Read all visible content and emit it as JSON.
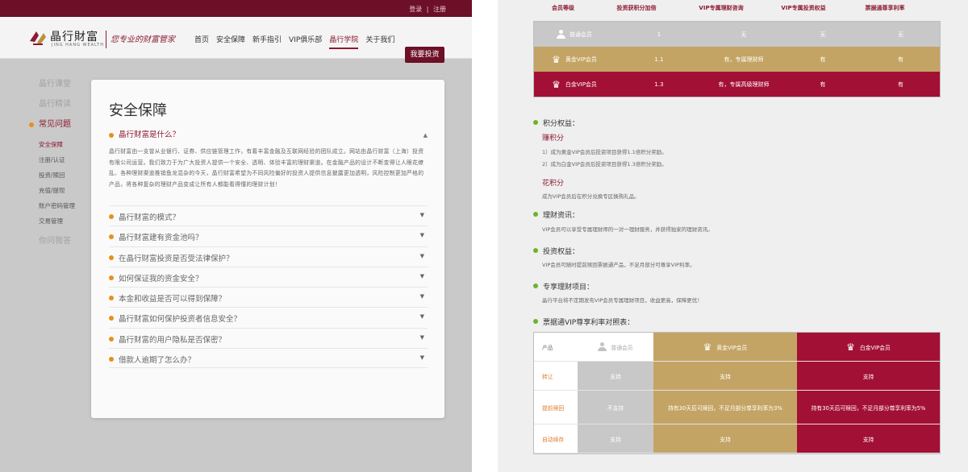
{
  "left": {
    "topbar": {
      "login": "登录",
      "sep": "|",
      "register": "注册"
    },
    "brand": {
      "name": "晶行財富",
      "sub": "JING HANG WEALTH",
      "slogan": "您专业的财富管家"
    },
    "nav": [
      "首页",
      "安全保障",
      "新手指引",
      "VIP俱乐部",
      "晶行学院",
      "关于我们"
    ],
    "nav_active_index": 4,
    "invest_button": "我要投资",
    "sidebar": {
      "items": [
        {
          "label": "晶行课堂"
        },
        {
          "label": "晶行精读"
        },
        {
          "label": "常见问题"
        }
      ],
      "subitems": [
        "安全保障",
        "注册/认证",
        "投资/赎回",
        "充值/提现",
        "账户密码管理",
        "交易管理"
      ],
      "bottom": "你问我答"
    },
    "card": {
      "title": "安全保障",
      "open_question": "晶行财富是什么？",
      "open_answer": "晶行财富由一支曾从业银行、证券、供应链管理工作，有着丰富金融及互联网经验的团队成立。网站由晶行财富（上海）投资有限公司运营。我们致力于为广大投资人提供一个安全、透明、体验丰富的理财渠道。在金融产品的设计不断变得让人眼花缭乱、各种理财渠道推销鱼龙混杂的今天，晶行财富希望为不同风险偏好的投资人提供信息披露更加透明，风险控制更加严格的产品，将各种复杂的理财产品变成让所有人都能看得懂的理财计划！",
      "questions": [
        "晶行财富的模式？",
        "晶行财富建有资金池吗？",
        "在晶行财富投资是否受法律保护？",
        "如何保证我的资金安全？",
        "本金和收益是否可以得到保障？",
        "晶行财富如何保护投资者信息安全？",
        "晶行财富的用户隐私是否保密？",
        "借款人逾期了怎么办？"
      ]
    }
  },
  "right": {
    "tier_headers": [
      "会员等级",
      "投资获积分加倍",
      "VIP专属理财咨询",
      "VIP专属投资权益",
      "票据通尊享利率"
    ],
    "tiers": [
      {
        "name": "普通会员",
        "cells": [
          "1",
          "无",
          "无",
          "无"
        ],
        "color": "#c8c8c8"
      },
      {
        "name": "黄金VIP会员",
        "cells": [
          "1.1",
          "有，专属理财师",
          "有",
          "有"
        ],
        "color": "#c4a464"
      },
      {
        "name": "白金VIP会员",
        "cells": [
          "1.3",
          "有，专属高级理财师",
          "有",
          "有"
        ],
        "color": "#a31035"
      }
    ],
    "points": {
      "title": "积分权益：",
      "earn_title": "赚积分",
      "earn_lines": [
        "1）成为黄金VIP会员后投资项目获得1.1倍积分奖励。",
        "2）成为白金VIP会员后投资项目获得1.3倍积分奖励。"
      ],
      "spend_title": "花积分",
      "spend_line": "成为VIP会员后在积分兑换专区换购礼品。"
    },
    "news": {
      "title": "理财资讯：",
      "text": "VIP会员可以享受专属理财师的一对一理财服务，并获得独家的理财资讯。"
    },
    "invest": {
      "title": "投资权益：",
      "text": "VIP会员可随时提前赎回票据通产品，不足月部分可尊享VIP利率。"
    },
    "project": {
      "title": "专享理财项目：",
      "text": "晶行平台将不定期发布VIP会员专属理财项目，收益更高，保障更优！"
    },
    "rate_table": {
      "title": "票据通VIP尊享利率对照表：",
      "header": [
        "产品",
        "普通会员",
        "黄金VIP会员",
        "白金VIP会员"
      ],
      "rows": [
        {
          "label": "转让",
          "cells": [
            "支持",
            "支持",
            "支持"
          ]
        },
        {
          "label": "提前赎回",
          "cells": [
            "不支持",
            "持有30天后可赎回，不足月部分尊享利率为3%",
            "持有30天后可赎回，不足月部分尊享利率为5%"
          ]
        },
        {
          "label": "自动续存",
          "cells": [
            "支持",
            "支持",
            "支持"
          ]
        }
      ]
    }
  }
}
